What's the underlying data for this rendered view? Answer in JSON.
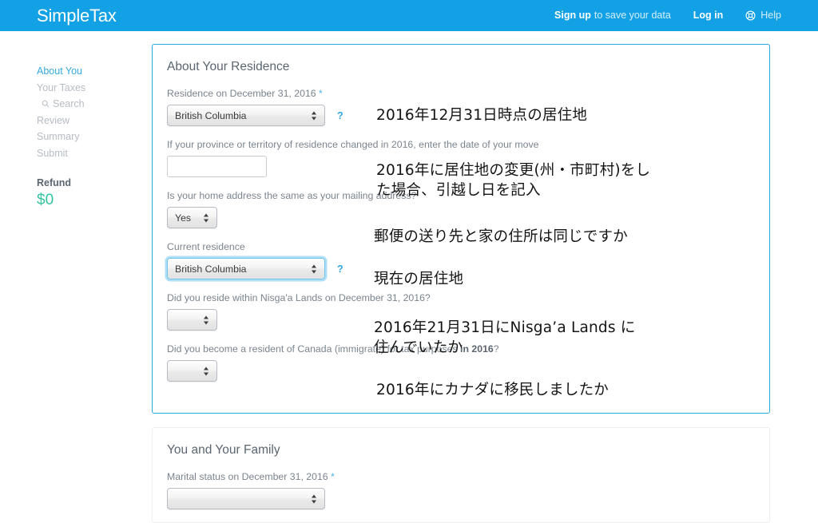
{
  "header": {
    "brand": "SimpleTax",
    "signup_strong": "Sign up",
    "signup_rest": "to save your data",
    "login": "Log in",
    "help": "Help",
    "help_icon": "lifebuoy-icon",
    "bg_color": "#12A1E5"
  },
  "sidebar": {
    "items": [
      {
        "label": "About You",
        "active": true
      },
      {
        "label": "Your Taxes",
        "active": false
      },
      {
        "label": "Search",
        "active": false,
        "icon": "magnifier-icon"
      },
      {
        "label": "Review",
        "active": false
      },
      {
        "label": "Summary",
        "active": false
      },
      {
        "label": "Submit",
        "active": false
      }
    ],
    "refund_label": "Refund",
    "refund_amount": "$0",
    "refund_color": "#35C4A2",
    "active_color": "#36A9E1"
  },
  "residence_panel": {
    "title": "About Your Residence",
    "border_color": "#29ABE2",
    "fields": {
      "residence_dec31": {
        "label": "Residence on December 31, 2016",
        "required_mark": "*",
        "value": "British Columbia",
        "help": "?"
      },
      "move_date": {
        "label": "If your province or territory of residence changed in 2016, enter the date of your move",
        "value": "",
        "placeholder": ""
      },
      "home_same_as_mailing": {
        "label": "Is your home address the same as your mailing address?",
        "value": "Yes"
      },
      "current_residence": {
        "label": "Current residence",
        "value": "British Columbia",
        "help": "?",
        "focused": true
      },
      "nisgaa_lands": {
        "label": "Did you reside within Nisga'a Lands on December 31, 2016?",
        "value": ""
      },
      "immigrate_2016": {
        "label_pre": "Did you become a resident of Canada (immigrate) for tax purposes ",
        "label_bold": "in 2016",
        "label_post": "?",
        "value": ""
      }
    }
  },
  "family_panel": {
    "title": "You and Your Family",
    "border_color": "#EDEFF1",
    "fields": {
      "marital_status": {
        "label": "Marital status on December 31, 2016",
        "required_mark": "*",
        "value": ""
      }
    }
  },
  "annotations": [
    {
      "text": "2016年12月31日時点の居住地"
    },
    {
      "text": "2016年に居住地の変更(州・市町村)をし\nた場合、引越し日を記入"
    },
    {
      "text": "郵便の送り先と家の住所は同じですか"
    },
    {
      "text": "現在の居住地"
    },
    {
      "text": "2016年21月31日にNisga’a Lands に\n住んでいたか"
    },
    {
      "text": "2016年にカナダに移民しましたか"
    }
  ]
}
